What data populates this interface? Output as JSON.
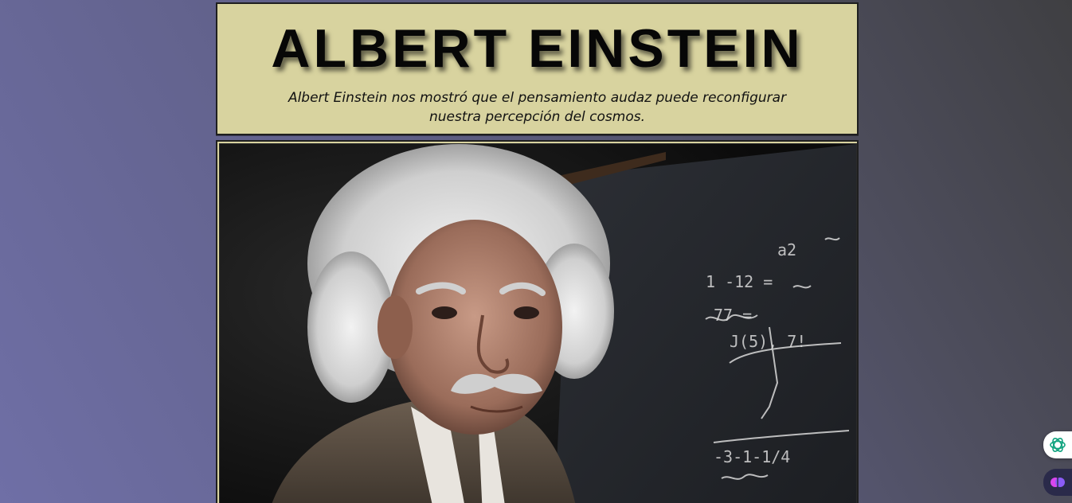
{
  "header": {
    "title": "ALBERT EINSTEIN",
    "subtitle": "Albert Einstein nos mostró que el pensamiento audaz puede reconfigurar nuestra percepción del cosmos."
  },
  "image": {
    "subject": "portrait of Albert Einstein in front of a chalkboard with equations"
  },
  "side_buttons": [
    {
      "icon": "openai-icon",
      "color": "#10a37f"
    },
    {
      "icon": "brain-icon",
      "color": "#d946ef"
    }
  ],
  "colors": {
    "panel": "#d8d39f",
    "border": "#1f1f1f"
  }
}
